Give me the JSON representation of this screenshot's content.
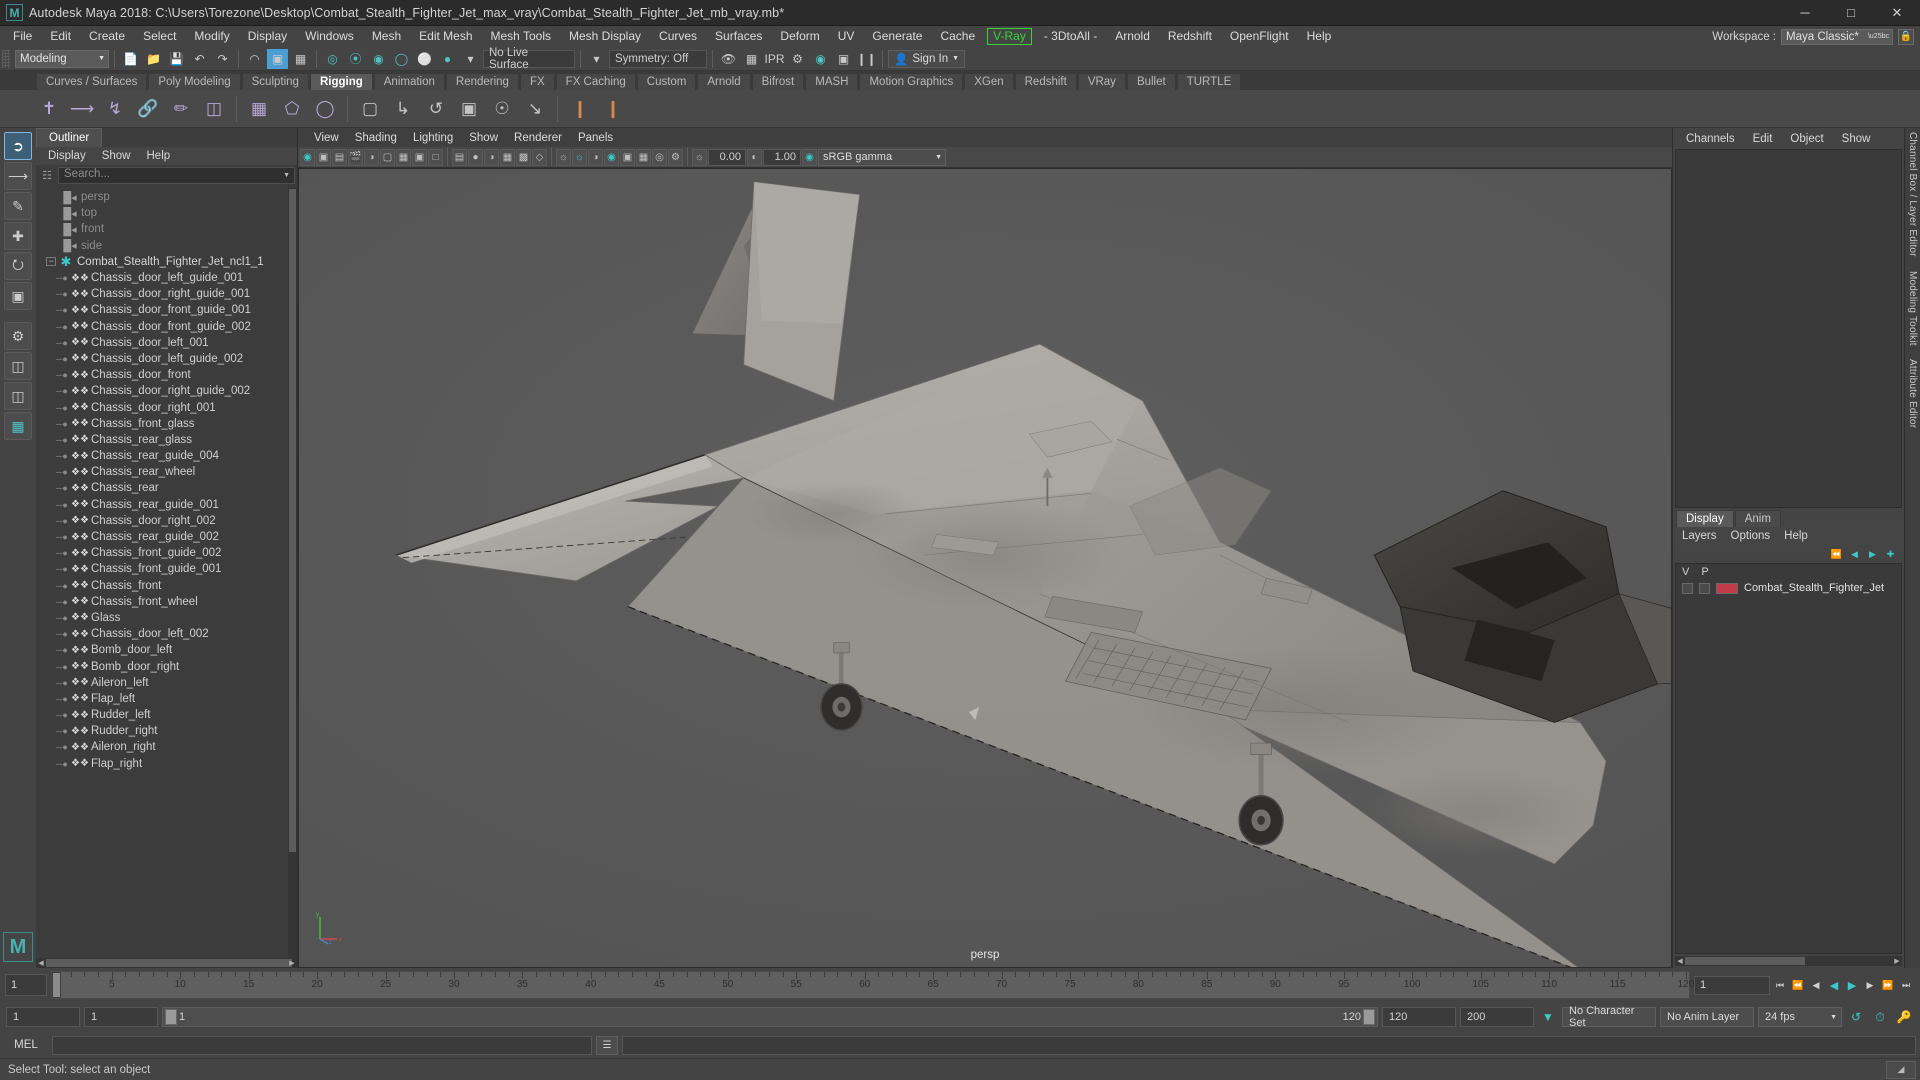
{
  "titlebar": {
    "app_title": "Autodesk Maya 2018: C:\\Users\\Torezone\\Desktop\\Combat_Stealth_Fighter_Jet_max_vray\\Combat_Stealth_Fighter_Jet_mb_vray.mb*",
    "logo": "M",
    "minimize": "─",
    "maximize": "□",
    "close": "✕"
  },
  "menubar": {
    "items": [
      "File",
      "Edit",
      "Create",
      "Select",
      "Modify",
      "Display",
      "Windows",
      "Mesh",
      "Edit Mesh",
      "Mesh Tools",
      "Mesh Display",
      "Curves",
      "Surfaces",
      "Deform",
      "UV",
      "Generate",
      "Cache"
    ],
    "vray": "V-Ray",
    "items_after": [
      "- 3DtoAll -",
      "Arnold",
      "Redshift",
      "OpenFlight",
      "Help"
    ],
    "workspace_label": "Workspace :",
    "workspace_value": "Maya Classic*",
    "lock_icon": "lock-icon"
  },
  "statusbar": {
    "mode": "Modeling",
    "live_surface": "No Live Surface",
    "symmetry": "Symmetry: Off",
    "frame_value": "",
    "signin": "Sign In"
  },
  "shelf": {
    "tabs": [
      "Curves / Surfaces",
      "Poly Modeling",
      "Sculpting",
      "Rigging",
      "Animation",
      "Rendering",
      "FX",
      "FX Caching",
      "Custom",
      "Arnold",
      "Bifrost",
      "MASH",
      "Motion Graphics",
      "XGen",
      "Redshift",
      "VRay",
      "Bullet",
      "TURTLE"
    ],
    "active_tab": "Rigging"
  },
  "outliner": {
    "tab_title": "Outliner",
    "menus": [
      "Display",
      "Show",
      "Help"
    ],
    "search_placeholder": "Search...",
    "cameras": [
      "persp",
      "top",
      "front",
      "side"
    ],
    "group": "Combat_Stealth_Fighter_Jet_ncl1_1",
    "meshes": [
      "Chassis_door_left_guide_001",
      "Chassis_door_right_guide_001",
      "Chassis_door_front_guide_001",
      "Chassis_door_front_guide_002",
      "Chassis_door_left_001",
      "Chassis_door_left_guide_002",
      "Chassis_door_front",
      "Chassis_door_right_guide_002",
      "Chassis_door_right_001",
      "Chassis_front_glass",
      "Chassis_rear_glass",
      "Chassis_rear_guide_004",
      "Chassis_rear_wheel",
      "Chassis_rear",
      "Chassis_rear_guide_001",
      "Chassis_door_right_002",
      "Chassis_rear_guide_002",
      "Chassis_front_guide_002",
      "Chassis_front_guide_001",
      "Chassis_front",
      "Chassis_front_wheel",
      "Glass",
      "Chassis_door_left_002",
      "Bomb_door_left",
      "Bomb_door_right",
      "Aileron_left",
      "Flap_left",
      "Rudder_left",
      "Rudder_right",
      "Aileron_right",
      "Flap_right"
    ]
  },
  "viewport": {
    "menus": [
      "View",
      "Shading",
      "Lighting",
      "Show",
      "Renderer",
      "Panels"
    ],
    "exposure_value": "0.00",
    "gamma_value": "1.00",
    "color_space": "sRGB gamma",
    "camera_label": "persp",
    "axis_x": "x",
    "axis_y": "y",
    "axis_z": "z"
  },
  "right_panel": {
    "tabs": [
      "Channels",
      "Edit",
      "Object",
      "Show"
    ],
    "edge_tabs": [
      "Channel Box / Layer Editor",
      "Modeling Toolkit",
      "Attribute Editor"
    ],
    "layer_tabs": [
      "Display",
      "Anim"
    ],
    "active_layer_tab": "Display",
    "layer_menus": [
      "Layers",
      "Options",
      "Help"
    ],
    "layer_col_v": "V",
    "layer_col_p": "P",
    "layers": [
      {
        "name": "Combat_Stealth_Fighter_Jet",
        "color": "#c33a4a"
      }
    ]
  },
  "timeline": {
    "current_frame": "1",
    "start": 1,
    "end": 120,
    "tick_labels": [
      5,
      10,
      15,
      20,
      25,
      30,
      35,
      40,
      45,
      50,
      55,
      60,
      65,
      70,
      75,
      80,
      85,
      90,
      95,
      100,
      105,
      110,
      115,
      120
    ],
    "frame_field": "1"
  },
  "playback": {
    "range_start": "1",
    "anim_start": "1",
    "slider_left_value": "1",
    "slider_right_value": "120",
    "range_end": "120",
    "anim_end": "200",
    "character_set": "No Character Set",
    "anim_layer": "No Anim Layer",
    "fps": "24 fps"
  },
  "command_line": {
    "language": "MEL",
    "input_value": "",
    "output_value": ""
  },
  "helpline": {
    "message": "Select Tool: select an object"
  },
  "colors": {
    "accent_cyan": "#3cc8c8",
    "accent_blue": "#4a9ed4",
    "vray_green": "#37d437",
    "layer_red": "#c33a4a",
    "panel_bg": "#444444",
    "viewport_bg": "#585858"
  }
}
